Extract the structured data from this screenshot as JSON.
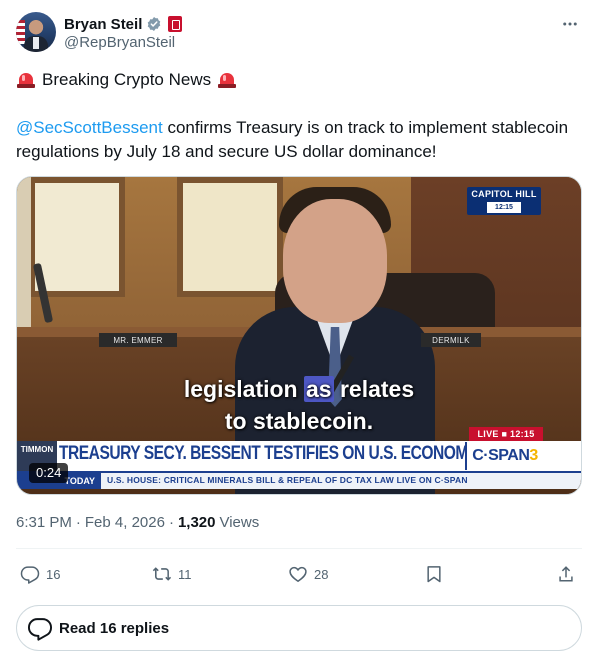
{
  "author": {
    "display_name": "Bryan Steil",
    "handle": "@RepBryanSteil"
  },
  "post": {
    "headline": "Breaking Crypto News",
    "mention": "@SecScottBessent",
    "text": " confirms Treasury is on track to implement stablecoin regulations by July 18 and secure US dollar dominance!"
  },
  "video": {
    "location_badge": "CAPITOL HILL",
    "badge_time": "12:15",
    "placard_left": "MR. EMMER",
    "placard_right": "DERMILK",
    "caption_line1_a": "legislation",
    "caption_line1_b": "as",
    "caption_line1_c": "relates",
    "caption_line2": "to stablecoin.",
    "live_label": "LIVE ■ 12:15",
    "lower_left": "TIMMON",
    "lower_title": "TREASURY SECY. BESSENT TESTIFIES ON U.S. ECONOMY",
    "network_name": "C·SPAN",
    "network_number": "3",
    "ticker_label": "TODAY",
    "ticker_text": "U.S. HOUSE: CRITICAL MINERALS BILL & REPEAL OF DC TAX LAW   LIVE ON C·SPAN",
    "timer": "0:24"
  },
  "meta": {
    "time": "6:31 PM",
    "date": "Feb 4, 2026",
    "views_count": "1,320",
    "views_label": "Views"
  },
  "actions": {
    "replies": "16",
    "reposts": "11",
    "likes": "28"
  },
  "replies_button": {
    "label": "Read 16 replies"
  },
  "icons": [
    "verified-icon",
    "more-icon",
    "siren-icon",
    "reply-icon",
    "repost-icon",
    "like-icon",
    "bookmark-icon",
    "share-icon",
    "replies-bubble-icon"
  ],
  "colors": {
    "accent": "#1d9bf0",
    "text": "#0f1419",
    "muted": "#536471",
    "border": "#cfd9de"
  }
}
